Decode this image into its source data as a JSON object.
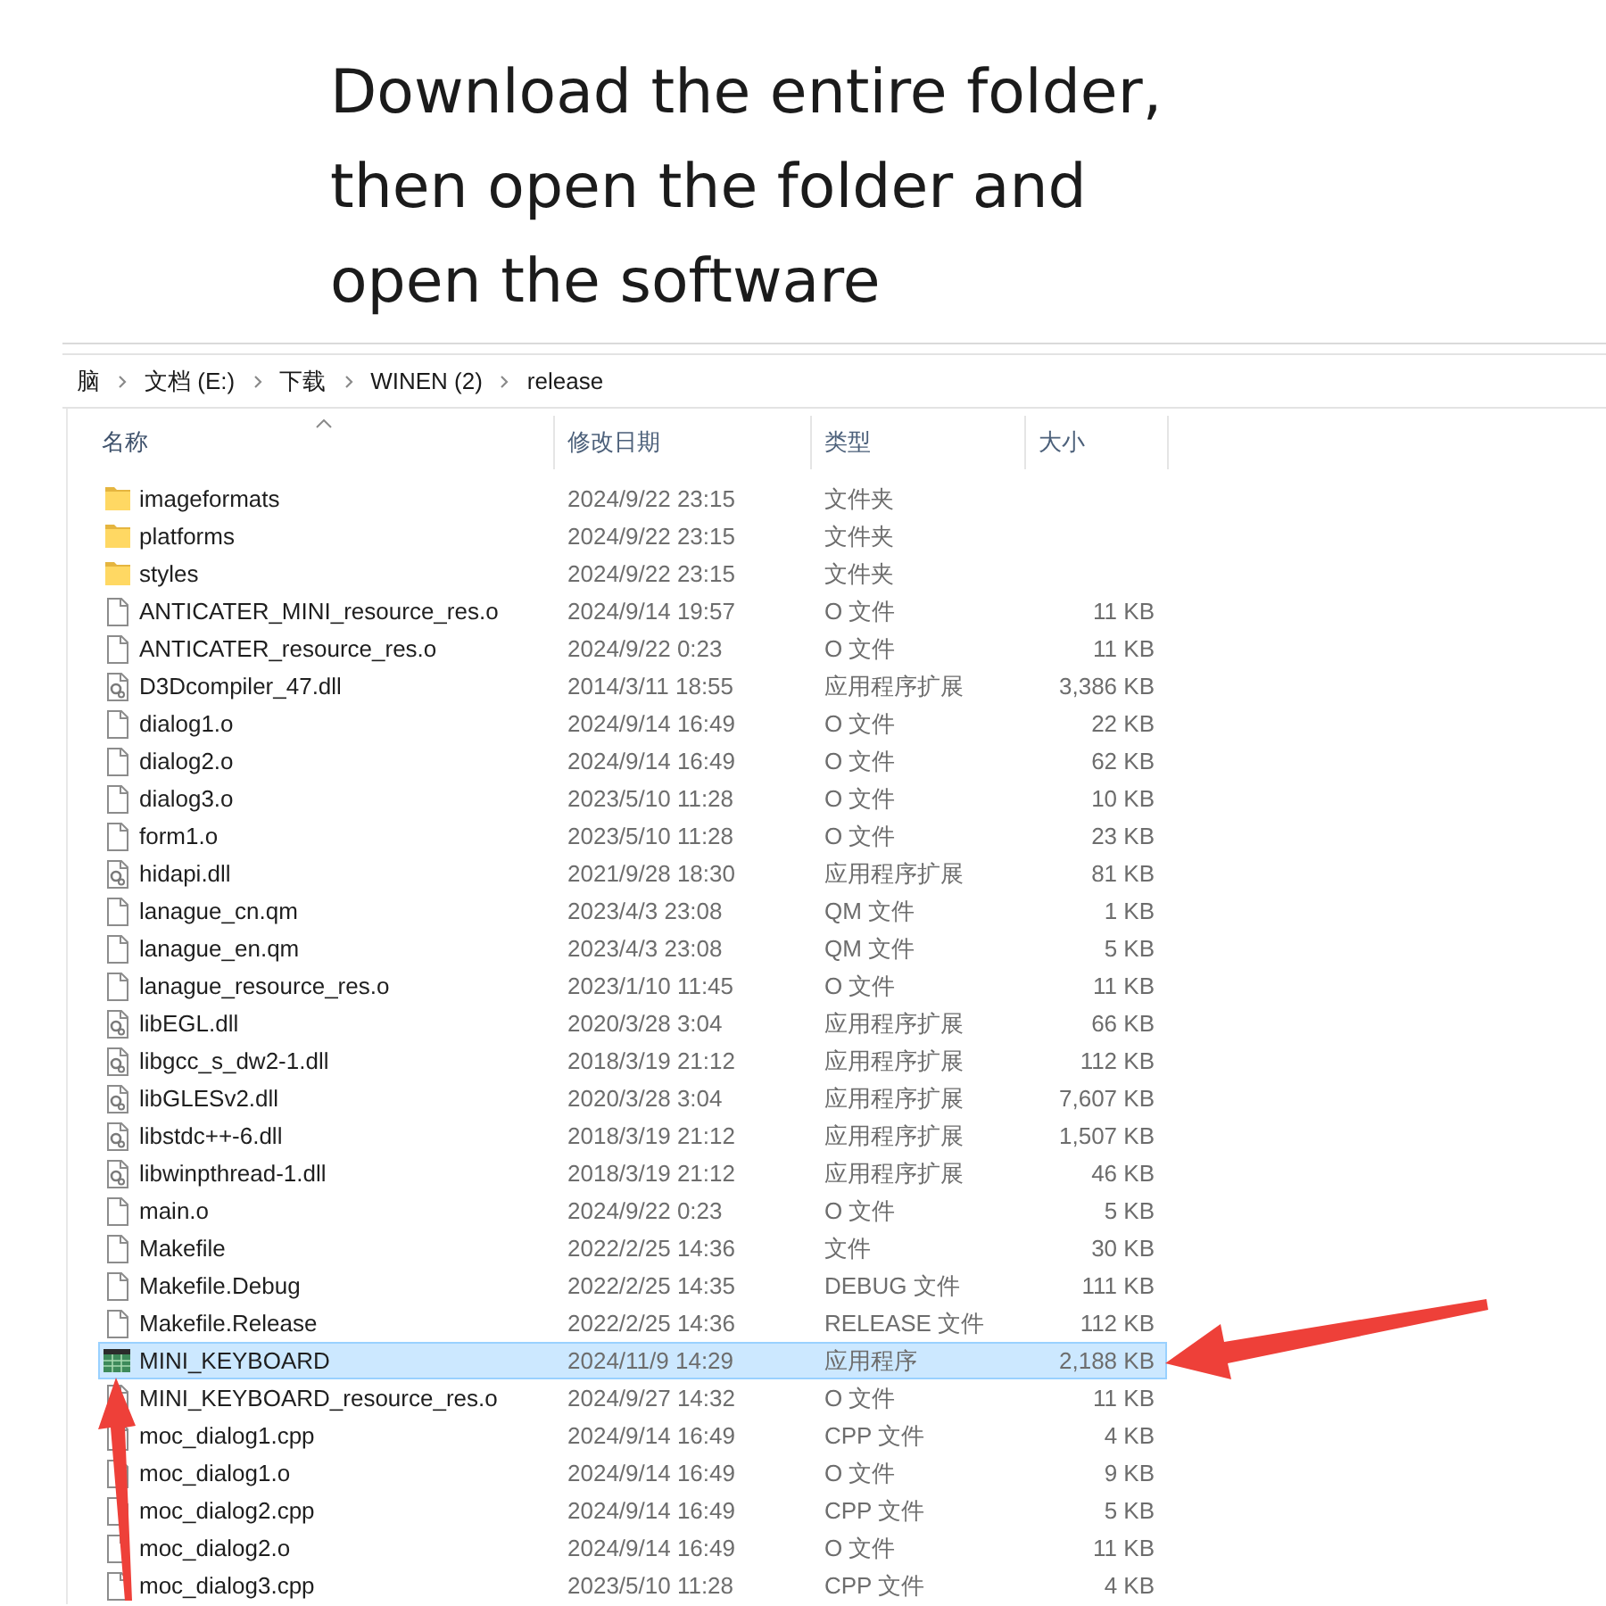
{
  "instruction": {
    "lines": [
      "Download the entire folder,",
      "then open the folder and",
      "open the software"
    ]
  },
  "breadcrumb": {
    "items": [
      "脑",
      "文档 (E:)",
      "下载",
      "WINEN (2)",
      "release"
    ]
  },
  "columns": [
    {
      "label": "名称",
      "sorted": true
    },
    {
      "label": "修改日期",
      "sorted": false
    },
    {
      "label": "类型",
      "sorted": false
    },
    {
      "label": "大小",
      "sorted": false
    }
  ],
  "rows": [
    {
      "name": "imageformats",
      "kind": "folder",
      "modified": "2024/9/22 23:15",
      "type": "文件夹",
      "selected": false
    },
    {
      "name": "platforms",
      "kind": "folder",
      "modified": "2024/9/22 23:15",
      "type": "文件夹",
      "selected": false
    },
    {
      "name": "styles",
      "kind": "folder",
      "modified": "2024/9/22 23:15",
      "type": "文件夹",
      "selected": false
    },
    {
      "name": "ANTICATER_MINI_resource_res.o",
      "kind": "file",
      "modified": "2024/9/14 19:57",
      "type": "O 文件",
      "size": "11 KB",
      "selected": false
    },
    {
      "name": "ANTICATER_resource_res.o",
      "kind": "file",
      "modified": "2024/9/22 0:23",
      "type": "O 文件",
      "size": "11 KB",
      "selected": false
    },
    {
      "name": "D3Dcompiler_47.dll",
      "kind": "dll",
      "modified": "2014/3/11 18:55",
      "type": "应用程序扩展",
      "size": "3,386 KB",
      "selected": false
    },
    {
      "name": "dialog1.o",
      "kind": "file",
      "modified": "2024/9/14 16:49",
      "type": "O 文件",
      "size": "22 KB",
      "selected": false
    },
    {
      "name": "dialog2.o",
      "kind": "file",
      "modified": "2024/9/14 16:49",
      "type": "O 文件",
      "size": "62 KB",
      "selected": false
    },
    {
      "name": "dialog3.o",
      "kind": "file",
      "modified": "2023/5/10 11:28",
      "type": "O 文件",
      "size": "10 KB",
      "selected": false
    },
    {
      "name": "form1.o",
      "kind": "file",
      "modified": "2023/5/10 11:28",
      "type": "O 文件",
      "size": "23 KB",
      "selected": false
    },
    {
      "name": "hidapi.dll",
      "kind": "dll",
      "modified": "2021/9/28 18:30",
      "type": "应用程序扩展",
      "size": "81 KB",
      "selected": false
    },
    {
      "name": "lanague_cn.qm",
      "kind": "file",
      "modified": "2023/4/3 23:08",
      "type": "QM 文件",
      "size": "1 KB",
      "selected": false
    },
    {
      "name": "lanague_en.qm",
      "kind": "file",
      "modified": "2023/4/3 23:08",
      "type": "QM 文件",
      "size": "5 KB",
      "selected": false
    },
    {
      "name": "lanague_resource_res.o",
      "kind": "file",
      "modified": "2023/1/10 11:45",
      "type": "O 文件",
      "size": "11 KB",
      "selected": false
    },
    {
      "name": "libEGL.dll",
      "kind": "dll",
      "modified": "2020/3/28 3:04",
      "type": "应用程序扩展",
      "size": "66 KB",
      "selected": false
    },
    {
      "name": "libgcc_s_dw2-1.dll",
      "kind": "dll",
      "modified": "2018/3/19 21:12",
      "type": "应用程序扩展",
      "size": "112 KB",
      "selected": false
    },
    {
      "name": "libGLESv2.dll",
      "kind": "dll",
      "modified": "2020/3/28 3:04",
      "type": "应用程序扩展",
      "size": "7,607 KB",
      "selected": false
    },
    {
      "name": "libstdc++-6.dll",
      "kind": "dll",
      "modified": "2018/3/19 21:12",
      "type": "应用程序扩展",
      "size": "1,507 KB",
      "selected": false
    },
    {
      "name": "libwinpthread-1.dll",
      "kind": "dll",
      "modified": "2018/3/19 21:12",
      "type": "应用程序扩展",
      "size": "46 KB",
      "selected": false
    },
    {
      "name": "main.o",
      "kind": "file",
      "modified": "2024/9/22 0:23",
      "type": "O 文件",
      "size": "5 KB",
      "selected": false
    },
    {
      "name": "Makefile",
      "kind": "file",
      "modified": "2022/2/25 14:36",
      "type": "文件",
      "size": "30 KB",
      "selected": false
    },
    {
      "name": "Makefile.Debug",
      "kind": "file",
      "modified": "2022/2/25 14:35",
      "type": "DEBUG 文件",
      "size": "111 KB",
      "selected": false
    },
    {
      "name": "Makefile.Release",
      "kind": "file",
      "modified": "2022/2/25 14:36",
      "type": "RELEASE 文件",
      "size": "112 KB",
      "selected": false
    },
    {
      "name": "MINI_KEYBOARD",
      "kind": "app",
      "modified": "2024/11/9 14:29",
      "type": "应用程序",
      "size": "2,188 KB",
      "selected": true
    },
    {
      "name": "MINI_KEYBOARD_resource_res.o",
      "kind": "file",
      "modified": "2024/9/27 14:32",
      "type": "O 文件",
      "size": "11 KB",
      "selected": false
    },
    {
      "name": "moc_dialog1.cpp",
      "kind": "file",
      "modified": "2024/9/14 16:49",
      "type": "CPP 文件",
      "size": "4 KB",
      "selected": false
    },
    {
      "name": "moc_dialog1.o",
      "kind": "file",
      "modified": "2024/9/14 16:49",
      "type": "O 文件",
      "size": "9 KB",
      "selected": false
    },
    {
      "name": "moc_dialog2.cpp",
      "kind": "file",
      "modified": "2024/9/14 16:49",
      "type": "CPP 文件",
      "size": "5 KB",
      "selected": false
    },
    {
      "name": "moc_dialog2.o",
      "kind": "file",
      "modified": "2024/9/14 16:49",
      "type": "O 文件",
      "size": "11 KB",
      "selected": false
    },
    {
      "name": "moc_dialog3.cpp",
      "kind": "file",
      "modified": "2023/5/10 11:28",
      "type": "CPP 文件",
      "size": "4 KB",
      "selected": false
    }
  ]
}
